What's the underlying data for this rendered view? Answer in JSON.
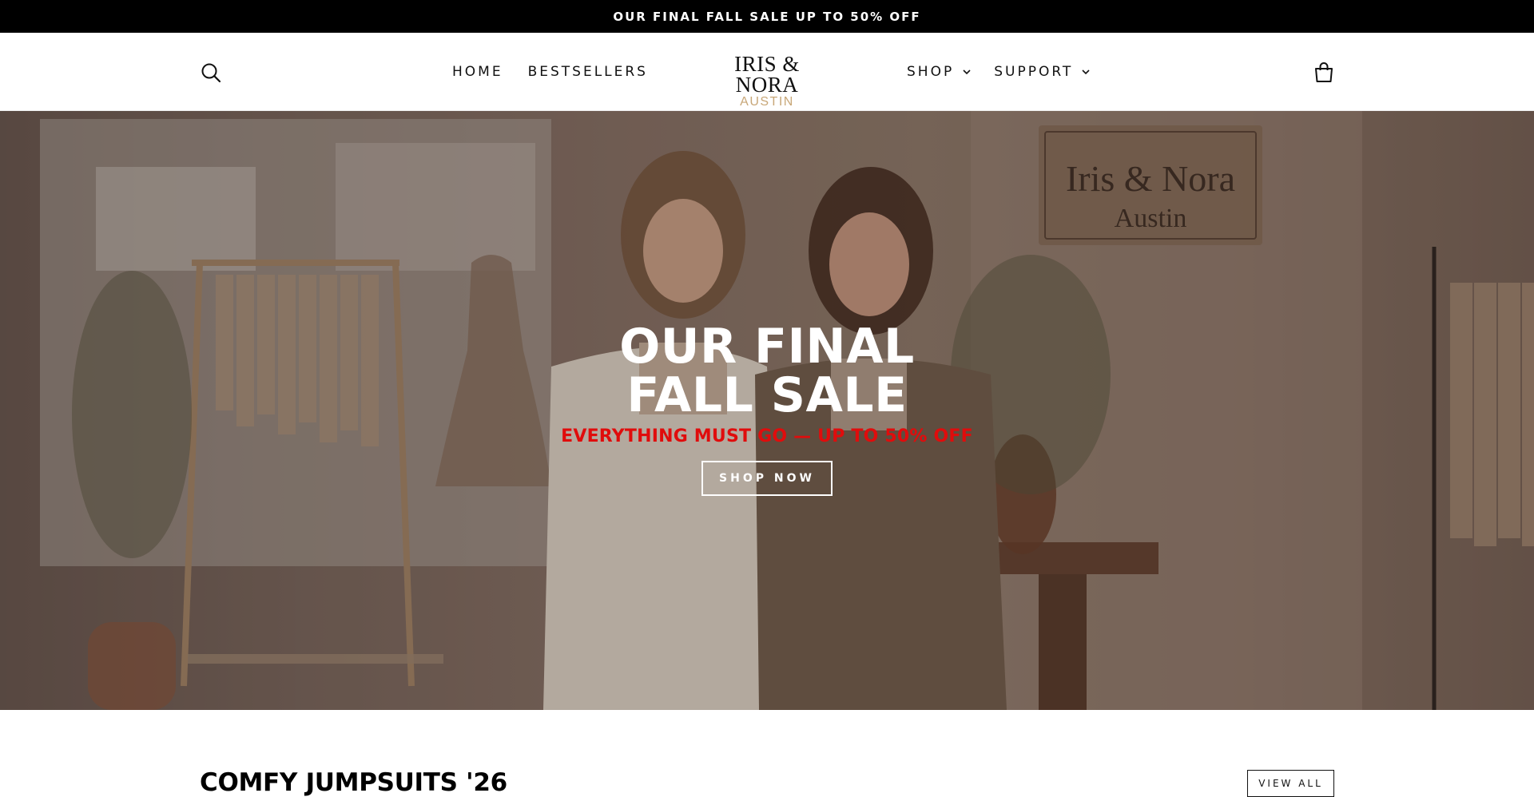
{
  "announcement": {
    "text": "OUR FINAL FALL SALE UP TO 50% OFF"
  },
  "header": {
    "nav_left": [
      {
        "label": "HOME"
      },
      {
        "label": "BESTSELLERS"
      }
    ],
    "logo": {
      "main": "IRIS & NORA",
      "sub": "AUSTIN"
    },
    "nav_right": [
      {
        "label": "SHOP",
        "has_dropdown": true
      },
      {
        "label": "SUPPORT",
        "has_dropdown": true
      }
    ],
    "icons": {
      "search": "search-icon",
      "cart": "shopping-bag-icon"
    }
  },
  "hero": {
    "title_line1": "OUR FINAL",
    "title_line2": "FALL SALE",
    "subtitle": "EVERYTHING MUST GO — UP TO 50% OFF",
    "button": "SHOP NOW",
    "sign_line1": "Iris & Nora",
    "sign_line2": "Austin",
    "colors": {
      "subtitle": "#e00c0c"
    }
  },
  "collection": {
    "title": "COMFY JUMPSUITS '26",
    "view_all": "VIEW ALL"
  }
}
